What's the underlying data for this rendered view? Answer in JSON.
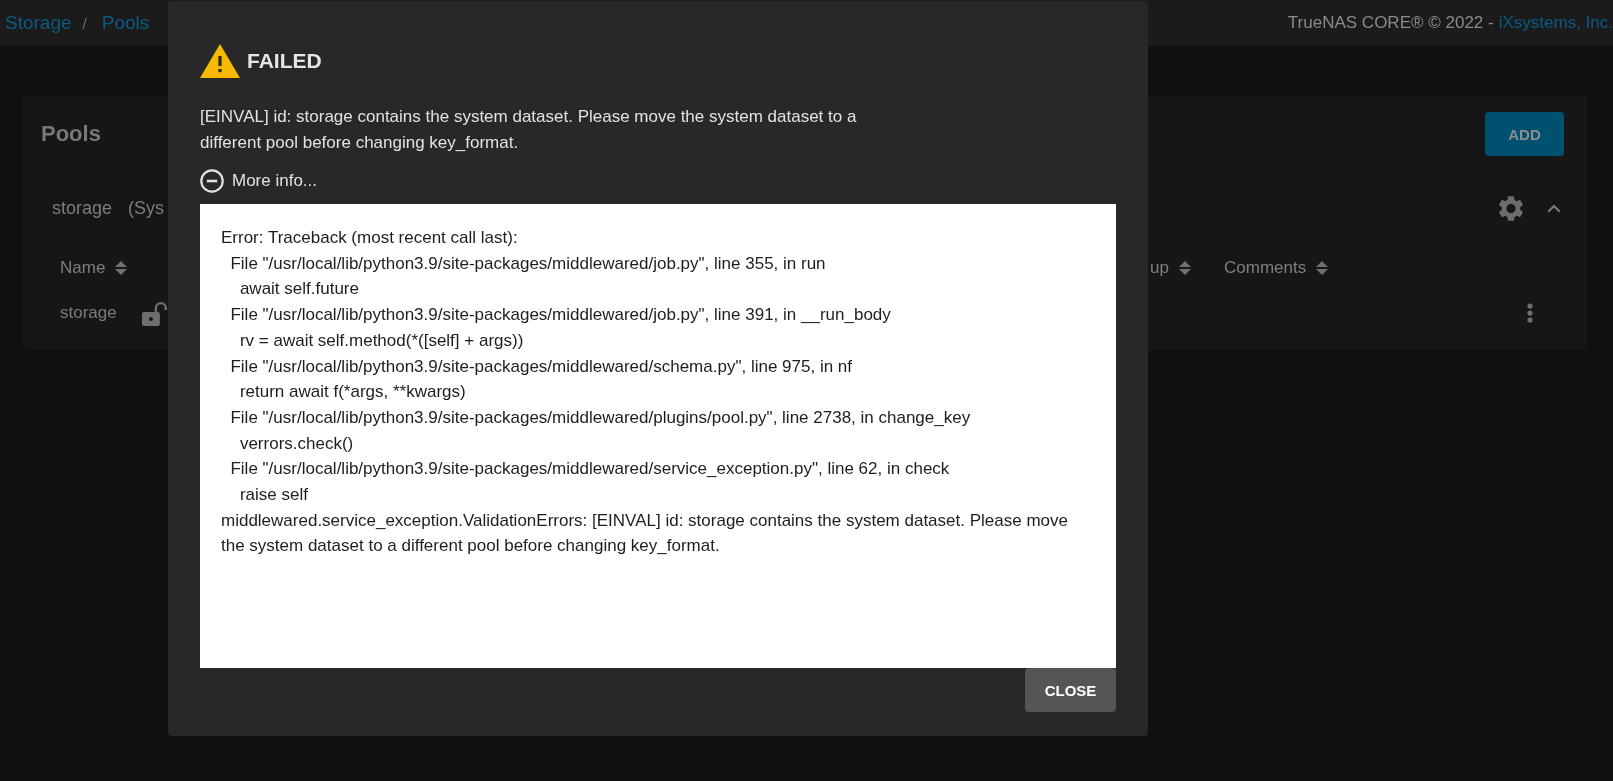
{
  "top_bar": {
    "breadcrumb": [
      {
        "label": "Storage"
      },
      {
        "label": "Pools"
      }
    ],
    "separator": "/",
    "copyright": "TrueNAS CORE® © 2022 -",
    "company_link": "iXsystems, Inc."
  },
  "pools_card": {
    "title": "Pools",
    "add_button": "ADD",
    "pool": {
      "name": "storage",
      "detail": "(Sys",
      "expanded": true
    },
    "columns": [
      "Name",
      "up",
      "Comments"
    ],
    "rows": [
      {
        "name": "storage",
        "locked": false
      }
    ]
  },
  "dialog": {
    "title": "FAILED",
    "message": "[EINVAL] id: storage contains the system dataset. Please move the system dataset to a different pool before changing key_format.",
    "more_info": {
      "label": "More info...",
      "expanded": true
    },
    "traceback": "Error: Traceback (most recent call last):\n  File \"/usr/local/lib/python3.9/site-packages/middlewared/job.py\", line 355, in run\n    await self.future\n  File \"/usr/local/lib/python3.9/site-packages/middlewared/job.py\", line 391, in __run_body\n    rv = await self.method(*([self] + args))\n  File \"/usr/local/lib/python3.9/site-packages/middlewared/schema.py\", line 975, in nf\n    return await f(*args, **kwargs)\n  File \"/usr/local/lib/python3.9/site-packages/middlewared/plugins/pool.py\", line 2738, in change_key\n    verrors.check()\n  File \"/usr/local/lib/python3.9/site-packages/middlewared/service_exception.py\", line 62, in check\n    raise self\nmiddlewared.service_exception.ValidationErrors: [EINVAL] id: storage contains the system dataset. Please move the system dataset to a different pool before changing key_format.",
    "close_button": "CLOSE"
  }
}
